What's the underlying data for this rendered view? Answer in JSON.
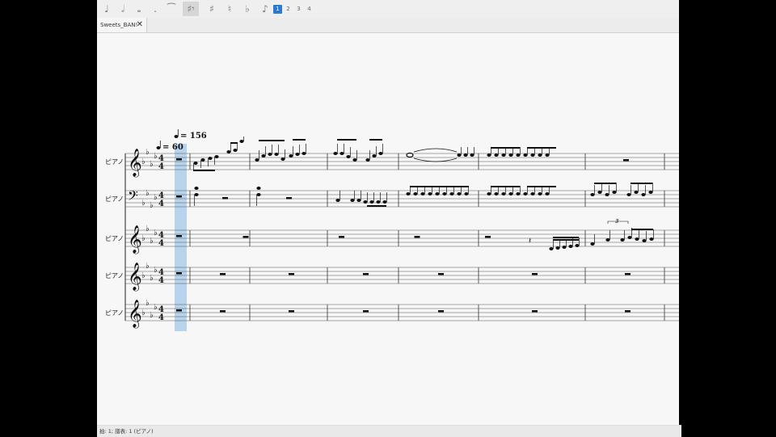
{
  "toolbar": {
    "buttons": [
      {
        "icon": "quarter-note-icon",
        "glyph": "♩"
      },
      {
        "icon": "half-note-icon",
        "glyph": "𝅗𝅥"
      },
      {
        "icon": "whole-note-icon",
        "glyph": "𝅝"
      },
      {
        "icon": "augmentation-dot-icon",
        "glyph": "."
      },
      {
        "icon": "tie-icon",
        "glyph": "⁀"
      },
      {
        "icon": "rest-icon",
        "glyph": "♯𝄾",
        "active": true
      },
      {
        "icon": "sharp-icon",
        "glyph": "♯"
      },
      {
        "icon": "natural-icon",
        "glyph": "♮"
      },
      {
        "icon": "flat-icon",
        "glyph": "♭"
      },
      {
        "icon": "flip-icon",
        "glyph": "♪"
      }
    ],
    "pages": [
      "1",
      "2",
      "3",
      "4"
    ],
    "active_page": "1"
  },
  "tab": {
    "title": "Sweets_BAN!",
    "close": "✕"
  },
  "score": {
    "tempo_marks": [
      {
        "label": "= 60"
      },
      {
        "label": "= 156"
      }
    ],
    "instruments": [
      "ピアノ",
      "ピアノ",
      "ピアノ",
      "ピアノ",
      "ピアノ"
    ],
    "key_signature": "A♭ major (4 flats)",
    "time_signature": [
      "4",
      "4"
    ],
    "tuplet_label": "3",
    "selection_color": "#b8d3ec"
  },
  "status": {
    "text": "拍: 1; 譜表: 1 (ピアノ)"
  }
}
